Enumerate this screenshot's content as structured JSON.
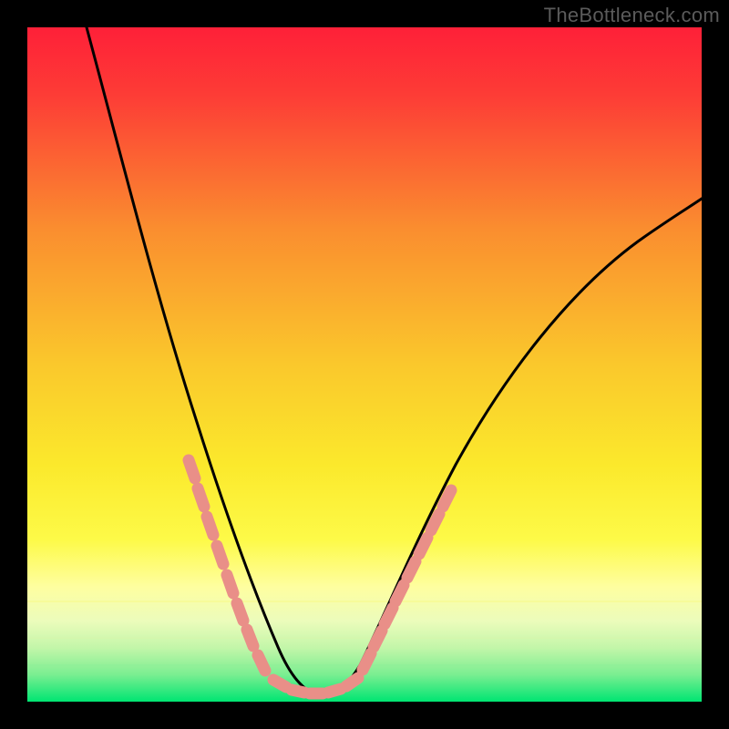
{
  "watermark": "TheBottleneck.com",
  "colors": {
    "gradient_top": "#fe2038",
    "gradient_mid1": "#fa8e2f",
    "gradient_mid2": "#fbe92c",
    "gradient_mid3": "#fefd76",
    "gradient_mid4": "#d6fa9d",
    "gradient_bottom": "#00e572",
    "curve": "#000000",
    "markers": "#e98f88",
    "frame": "#000000"
  },
  "chart_data": {
    "type": "line",
    "title": "",
    "xlabel": "",
    "ylabel": "",
    "xlim": [
      0,
      100
    ],
    "ylim": [
      0,
      100
    ],
    "grid": false,
    "series": [
      {
        "name": "bottleneck-curve",
        "x": [
          8,
          10,
          12,
          14,
          16,
          18,
          20,
          22,
          24,
          26,
          28,
          30,
          32,
          34,
          36,
          38,
          40,
          42,
          44,
          46,
          50,
          55,
          60,
          65,
          70,
          75,
          80,
          85,
          90,
          95,
          100
        ],
        "y": [
          100,
          93,
          86,
          79,
          72,
          65,
          58,
          51,
          45,
          38,
          32,
          26,
          20,
          15,
          10,
          6,
          3,
          1,
          0,
          1,
          6,
          14,
          23,
          31,
          39,
          46,
          52,
          57,
          62,
          66,
          70
        ]
      }
    ],
    "markers": [
      {
        "name": "left-cluster",
        "x_range": [
          23,
          35
        ],
        "y_range": [
          5,
          40
        ]
      },
      {
        "name": "bottom-cluster",
        "x_range": [
          36,
          47
        ],
        "y_range": [
          0,
          4
        ]
      },
      {
        "name": "right-cluster",
        "x_range": [
          48,
          58
        ],
        "y_range": [
          5,
          30
        ]
      }
    ],
    "annotations": []
  }
}
